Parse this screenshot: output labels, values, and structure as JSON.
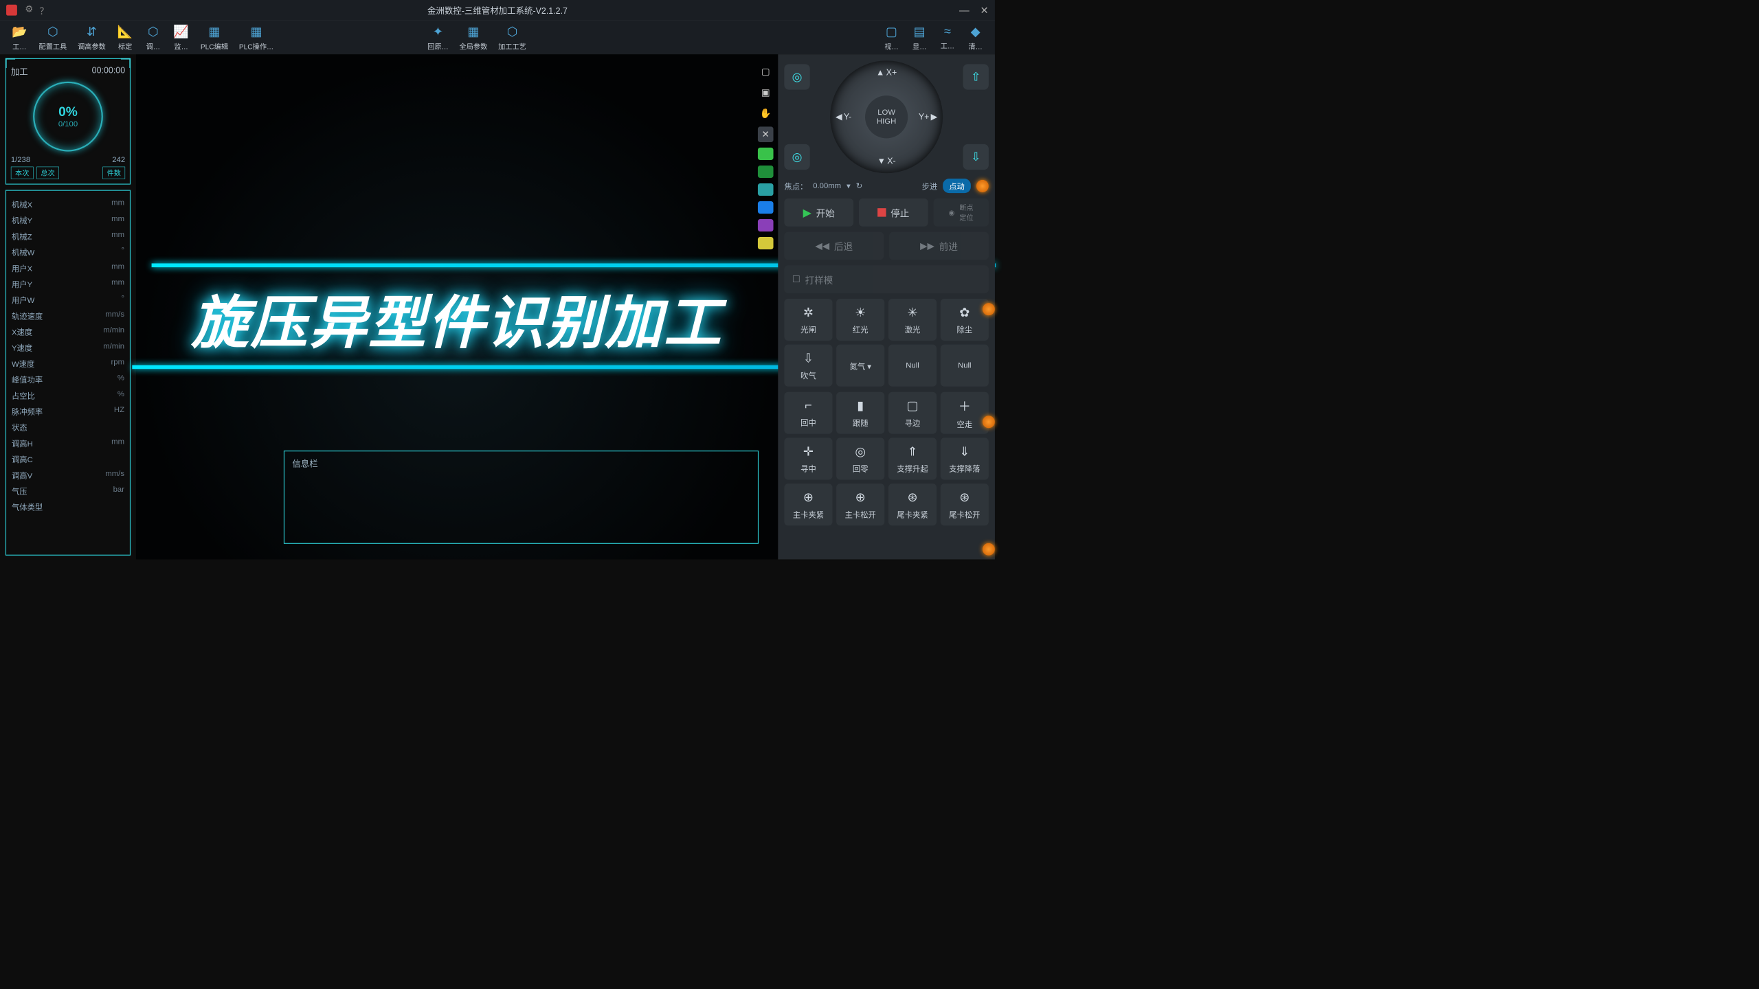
{
  "title": "金洲数控-三维管材加工系统-V2.1.2.7",
  "toolbar": [
    {
      "icon": "📂",
      "label": "工…"
    },
    {
      "icon": "⬡",
      "label": "配置工具"
    },
    {
      "icon": "⇵",
      "label": "调高参数"
    },
    {
      "icon": "📐",
      "label": "标定"
    },
    {
      "icon": "⬡",
      "label": "调…"
    },
    {
      "icon": "📈",
      "label": "监…"
    },
    {
      "icon": "▦",
      "label": "PLC编辑"
    },
    {
      "icon": "▦",
      "label": "PLC操作…"
    }
  ],
  "toolbar_mid": [
    {
      "icon": "✦",
      "label": "回原…"
    },
    {
      "icon": "▦",
      "label": "全局参数"
    },
    {
      "icon": "⬡",
      "label": "加工工艺"
    }
  ],
  "toolbar_right": [
    {
      "icon": "▢",
      "label": "视…"
    },
    {
      "icon": "▤",
      "label": "显…"
    },
    {
      "icon": "≈",
      "label": "工…"
    },
    {
      "icon": "◆",
      "label": "清…"
    }
  ],
  "progress": {
    "title": "加工",
    "time": "00:00:00",
    "pct": "0%",
    "sub": "0/100",
    "left": "1/238",
    "right": "242",
    "tag1": "本次",
    "tag2": "总次",
    "tag3": "件数"
  },
  "stats": [
    {
      "label": "机械X",
      "unit": "mm"
    },
    {
      "label": "机械Y",
      "unit": "mm"
    },
    {
      "label": "机械Z",
      "unit": "mm"
    },
    {
      "label": "机械W",
      "unit": "°"
    },
    {
      "label": "用户X",
      "unit": "mm"
    },
    {
      "label": "用户Y",
      "unit": "mm"
    },
    {
      "label": "用户W",
      "unit": "°"
    },
    {
      "label": "轨迹速度",
      "unit": "mm/s"
    },
    {
      "label": "X速度",
      "unit": "m/min"
    },
    {
      "label": "Y速度",
      "unit": "m/min"
    },
    {
      "label": "W速度",
      "unit": "rpm"
    },
    {
      "label": "峰值功率",
      "unit": "%"
    },
    {
      "label": "占空比",
      "unit": "%"
    },
    {
      "label": "脉冲频率",
      "unit": "HZ"
    },
    {
      "label": "状态",
      "unit": ""
    },
    {
      "label": "调高H",
      "unit": "mm"
    },
    {
      "label": "调高C",
      "unit": ""
    },
    {
      "label": "调高V",
      "unit": "mm/s"
    },
    {
      "label": "气压",
      "unit": "bar"
    },
    {
      "label": "气体类型",
      "unit": ""
    }
  ],
  "overlay_text": "旋压异型件识别加工",
  "info_title": "信息栏",
  "jog": {
    "xp": "X+",
    "xm": "X-",
    "yp": "Y+",
    "ym": "Y-",
    "low": "LOW",
    "high": "HIGH"
  },
  "focus": {
    "label": "焦点：",
    "value": "0.00mm",
    "step": "步进",
    "jog": "点动"
  },
  "ctrl": {
    "start": "开始",
    "stop": "停止",
    "bp": "断点\n定位",
    "back": "后退",
    "fwd": "前进",
    "sample": "打样模"
  },
  "grid1": [
    {
      "icon": "✲",
      "label": "光闸"
    },
    {
      "icon": "☀",
      "label": "红光"
    },
    {
      "icon": "✳",
      "label": "激光"
    },
    {
      "icon": "✿",
      "label": "除尘"
    },
    {
      "icon": "⇩",
      "label": "吹气"
    },
    {
      "icon": "",
      "label": "氮气 ▾"
    },
    {
      "icon": "",
      "label": "Null"
    },
    {
      "icon": "",
      "label": "Null"
    }
  ],
  "grid2": [
    {
      "icon": "⌐",
      "label": "回中"
    },
    {
      "icon": "▮",
      "label": "跟随"
    },
    {
      "icon": "▢",
      "label": "寻边"
    },
    {
      "icon": "＋",
      "label": "空走"
    },
    {
      "icon": "✛",
      "label": "寻中"
    },
    {
      "icon": "◎",
      "label": "回零"
    },
    {
      "icon": "⇑",
      "label": "支撑升起"
    },
    {
      "icon": "⇓",
      "label": "支撑降落"
    },
    {
      "icon": "⊕",
      "label": "主卡夹紧"
    },
    {
      "icon": "⊕",
      "label": "主卡松开"
    },
    {
      "icon": "⊛",
      "label": "尾卡夹紧"
    },
    {
      "icon": "⊛",
      "label": "尾卡松开"
    }
  ],
  "color_chips": [
    "#39c24a",
    "#1f8f3a",
    "#2aa0a4",
    "#1a7ee8",
    "#8a3fb8",
    "#d4c83a"
  ]
}
